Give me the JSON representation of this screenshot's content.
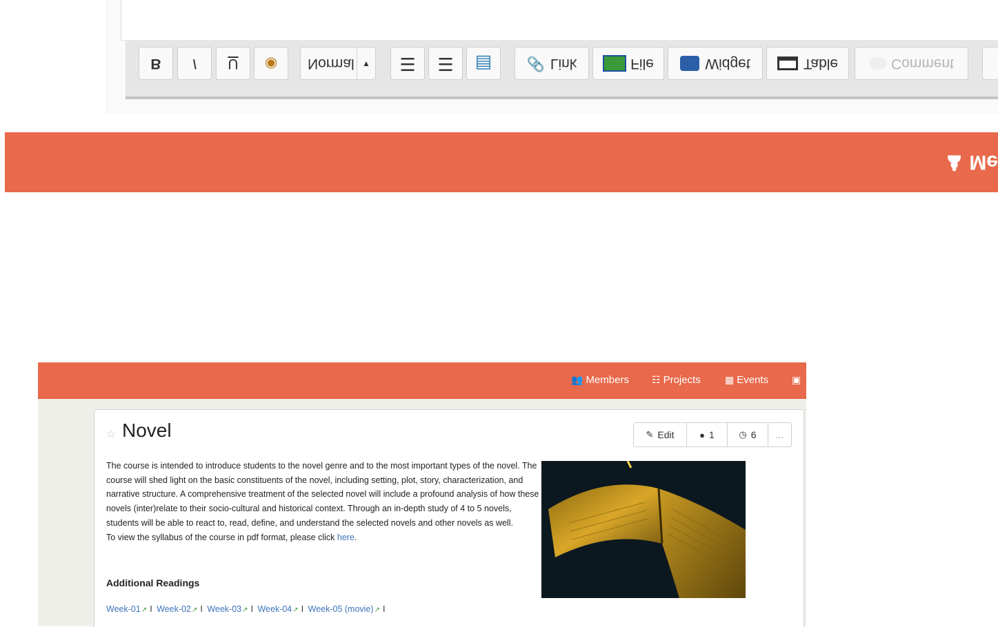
{
  "toolbar": {
    "bold": "B",
    "italic": "I",
    "underline": "U",
    "font_size": "Normal",
    "link": "Link",
    "file": "File",
    "widget": "Widget",
    "table": "Table",
    "comment": "Comment"
  },
  "band_label": "Me",
  "nav": {
    "members": "Members",
    "projects": "Projects",
    "events": "Events"
  },
  "page": {
    "title": "Novel",
    "actions": {
      "edit": "Edit",
      "comments_count": "1",
      "history_count": "6",
      "more": "..."
    },
    "description": "The course is intended to introduce students to the novel genre and to the most important types of the novel. The course will shed light on the basic constituents of the novel, including setting, plot, story, characterization, and narrative structure. A comprehensive treatment of the selected novel will include a profound analysis of how these novels (inter)relate to their socio-cultural and historical context. Through an in-depth study of 4 to 5 novels, students will be able to react to, read, define, and understand the selected novels and other novels as well.",
    "syllabus_text": "To view the syllabus of the course in pdf format, please click",
    "syllabus_link": "here",
    "syllabus_end": ".",
    "additional_heading": "Additional Readings",
    "weeks": [
      "Week-01",
      "Week-02",
      "Week-03",
      "Week-04",
      "Week-05 (movie)"
    ],
    "week_separator": "I"
  },
  "colors": {
    "brand": "#e8694b",
    "link": "#3b73b9"
  }
}
